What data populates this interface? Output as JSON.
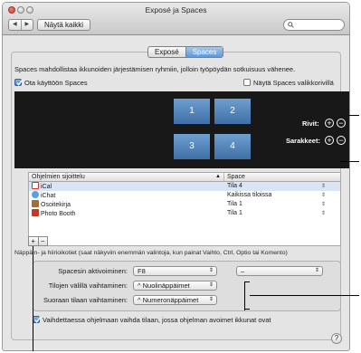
{
  "window": {
    "title": "Exposé ja Spaces"
  },
  "toolbar": {
    "back": "◀",
    "forward": "▶",
    "show_all": "Näytä kaikki",
    "search_placeholder": ""
  },
  "tabs": [
    {
      "label": "Exposé"
    },
    {
      "label": "Spaces"
    }
  ],
  "description": "Spaces mahdollistaa ikkunoiden järjestämisen ryhmiin, jolloin työpöydän sotkuisuus vähenee.",
  "enable_spaces": {
    "label": "Ota käyttöön Spaces",
    "checked": true
  },
  "show_in_menu": {
    "label": "Näytä Spaces valikkorivillä",
    "checked": false
  },
  "spaces_grid": {
    "tiles": [
      "1",
      "2",
      "3",
      "4"
    ],
    "rows_label": "Rivit:",
    "columns_label": "Sarakkeet:"
  },
  "bindings_table": {
    "headers": [
      "Ohjelmien sijoittelu",
      "Space"
    ],
    "sort_indicator": "▲",
    "rows": [
      {
        "app": "iCal",
        "space": "Tila 4",
        "icon": "calendar-icon",
        "selected": true
      },
      {
        "app": "iChat",
        "space": "Kaikissa tiloissa",
        "icon": "chat-icon",
        "selected": false
      },
      {
        "app": "Osoitekirja",
        "space": "Tila 1",
        "icon": "address-book-icon",
        "selected": false
      },
      {
        "app": "Photo Booth",
        "space": "Tila 1",
        "icon": "photo-booth-icon",
        "selected": false
      }
    ]
  },
  "add_button": "+",
  "remove_button": "−",
  "shortcuts_hint": "Näppäin- ja hiirioikotiet (saat näkyviin enemmän valintoja, kun painat Vaihto, Ctrl, Optio tai Komento)",
  "shortcuts": {
    "activate_label": "Spacesin aktivoiminen:",
    "activate_value": "F8",
    "activate_mouse_value": "–",
    "switch_label": "Tilojen välillä vaihtaminen:",
    "switch_value": "^ Nuolinäppäimet",
    "direct_label": "Suoraan tilaan vaihtaminen:",
    "direct_value": "^ Numeronäppäimet"
  },
  "switch_on_activate": {
    "label": "Vaihdettaessa ohjelmaan vaihda tilaan, jossa ohjelman avoimet ikkunat ovat",
    "checked": true
  },
  "help": "?",
  "colors": {
    "accent": "#5f98d6",
    "preview_bg": "#181818",
    "tile": "#4f82ba"
  }
}
